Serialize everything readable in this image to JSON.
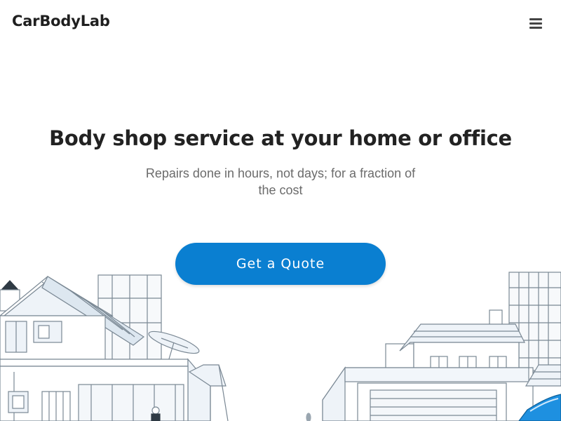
{
  "header": {
    "logo": "CarBodyLab",
    "menu_icon": "hamburger-menu-icon"
  },
  "hero": {
    "title": "Body shop service at your home or office",
    "subtitle": "Repairs done in hours, not days; for a fraction of the cost",
    "cta_label": "Get a Quote"
  },
  "colors": {
    "accent": "#0a7fd1",
    "title_text": "#222222",
    "subtitle_text": "#6b6b6b",
    "line_art": "#7a8894",
    "line_art_fill": "#dde7f0",
    "van_blue": "#1e90e0"
  }
}
